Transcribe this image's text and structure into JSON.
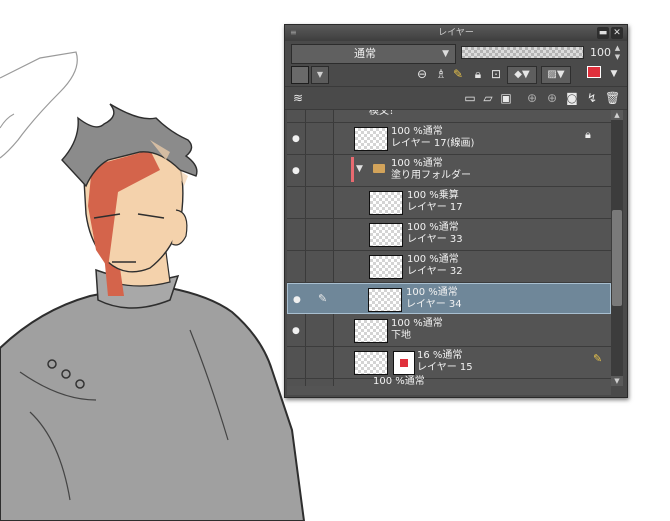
{
  "canvas": {
    "colors": {
      "skin": "#f4d2ac",
      "red": "#d4644b",
      "hair": "#8b8b8b",
      "clothes": "#9e9e9e",
      "line": "#333333"
    }
  },
  "panel": {
    "title": "レイヤー",
    "minimize_icon": "minimize-icon",
    "close_icon": "close-icon",
    "blend_mode": "通常",
    "opacity_value": "100",
    "layers": [
      {
        "opacity_mode": "",
        "name": "模文！"
      },
      {
        "opacity_mode": "100 %通常",
        "name": "レイヤー 17(線画)"
      },
      {
        "opacity_mode": "100 %通常",
        "name": "塗り用フォルダー"
      },
      {
        "opacity_mode": "100 %乗算",
        "name": "レイヤー 17"
      },
      {
        "opacity_mode": "100 %通常",
        "name": "レイヤー 33"
      },
      {
        "opacity_mode": "100 %通常",
        "name": "レイヤー 32"
      },
      {
        "opacity_mode": "100 %通常",
        "name": "レイヤー 34"
      },
      {
        "opacity_mode": "100 %通常",
        "name": "下地"
      },
      {
        "opacity_mode": "16 %通常",
        "name": "レイヤー 15"
      },
      {
        "opacity_mode": "100 %通常",
        "name": ""
      }
    ],
    "colors": {
      "panel_bg": "#4a4a4a",
      "list_bg": "#545454",
      "selected": "#6f8799",
      "folder_indicator": "#e86a70",
      "red_swatch": "#e0303c"
    }
  }
}
